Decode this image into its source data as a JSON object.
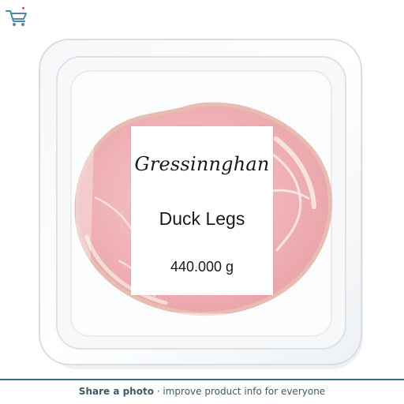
{
  "product": {
    "brand": "Gressinnghan",
    "name": "Duck Legs",
    "weight": "440.000 g"
  },
  "footer": {
    "share_label": "Share a photo",
    "rest_text": " · improve product info for everyone"
  },
  "icons": {
    "logo": "shopping-cart-icon",
    "image": "packaged-meat-tray-illustration"
  },
  "colors": {
    "footer_accent": "#3c6e7e",
    "footer_text": "#3f5a66",
    "logo_cart": "#4f8aa0",
    "logo_heart": "#d24a6a"
  }
}
